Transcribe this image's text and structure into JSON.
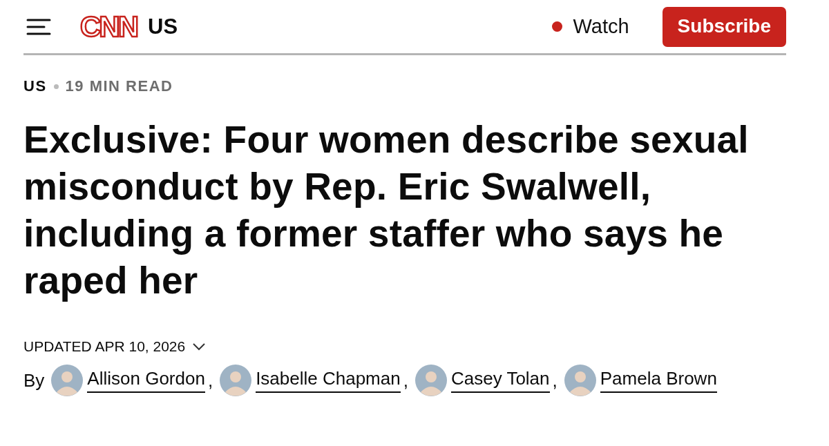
{
  "header": {
    "logo": "CNN",
    "section": "US",
    "watch": {
      "label": "Watch",
      "live": true
    },
    "subscribe": "Subscribe"
  },
  "meta": {
    "category": "US",
    "read_time": "19 MIN READ"
  },
  "headline": "Exclusive: Four women describe sexual misconduct by Rep. Eric Swalwell, including a former staffer who says he raped her",
  "updated": {
    "label": "UPDATED APR 10, 2026",
    "expanded": false
  },
  "byline": {
    "prefix": "By",
    "authors": [
      {
        "name": "Allison Gordon"
      },
      {
        "name": "Isabelle Chapman"
      },
      {
        "name": "Casey Tolan"
      },
      {
        "name": "Pamela Brown"
      }
    ],
    "separator": ","
  }
}
